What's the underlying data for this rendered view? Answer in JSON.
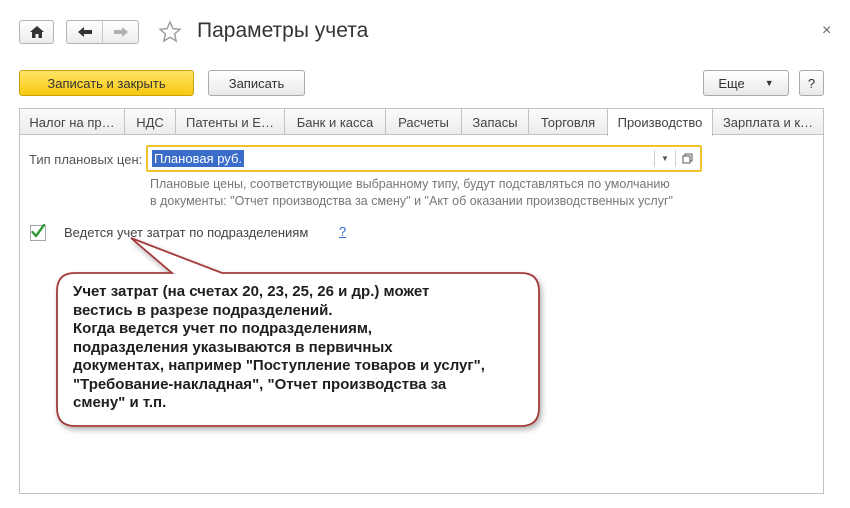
{
  "window": {
    "title": "Параметры учета",
    "close_glyph": "×"
  },
  "toolbar": {
    "save_close_label": "Записать и закрыть",
    "save_label": "Записать",
    "more_label": "Еще",
    "more_arrow": "▼",
    "help_label": "?"
  },
  "tabs": [
    {
      "label": "Налог на пр…"
    },
    {
      "label": "НДС"
    },
    {
      "label": "Патенты и Е…"
    },
    {
      "label": "Банк и касса"
    },
    {
      "label": "Расчеты"
    },
    {
      "label": "Запасы"
    },
    {
      "label": "Торговля"
    },
    {
      "label": "Производство",
      "active": true
    },
    {
      "label": "Зарплата и к…"
    }
  ],
  "form": {
    "plan_price_label": "Тип плановых цен:",
    "plan_price_value": "Плановая руб.",
    "hint_line1": "Плановые цены, соответствующие выбранному типу, будут подставляться по умолчанию",
    "hint_line2": "в документы: \"Отчет производства за смену\" и \"Акт об оказании производственных услуг\"",
    "dept_checkbox_label": "Ведется учет затрат по подразделениям",
    "dept_checkbox_checked": true,
    "help_link": "?"
  },
  "callout": {
    "line1": "Учет затрат (на счетах 20, 23, 25, 26 и др.) может",
    "line2": "вестись в разрезе подразделений.",
    "line3": "Когда ведется учет по подразделениям,",
    "line4": "подразделения указываются в первичных",
    "line5": "документах, например \"Поступление товаров и услуг\",",
    "line6": "\"Требование-накладная\", \"Отчет производства за",
    "line7": "смену\" и т.п."
  },
  "colors": {
    "primary_button": "#f8c911",
    "selection": "#3a6cc9",
    "callout_border": "#a33a3a",
    "checkmark": "#2e9a3a"
  },
  "icons": [
    "home-icon",
    "back-arrow-icon",
    "forward-arrow-icon",
    "star-icon",
    "dropdown-arrow-icon",
    "open-icon",
    "checkmark-icon"
  ]
}
